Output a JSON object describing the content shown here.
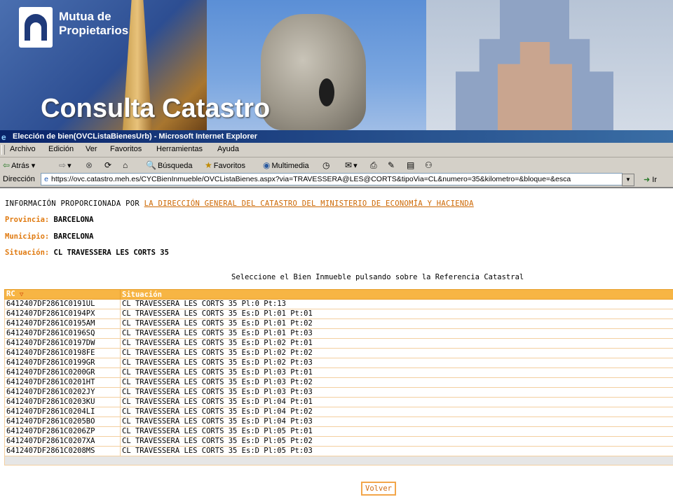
{
  "banner": {
    "logo_line1": "Mutua de",
    "logo_line2": "Propietarios",
    "title": "Consulta Catastro"
  },
  "window": {
    "title": "Elección de bien(OVCListaBienesUrb) - Microsoft Internet Explorer"
  },
  "menu": [
    "Archivo",
    "Edición",
    "Ver",
    "Favoritos",
    "Herramientas",
    "Ayuda"
  ],
  "toolbar": {
    "back": "Atrás",
    "search": "Búsqueda",
    "favorites": "Favoritos",
    "media": "Multimedia"
  },
  "address": {
    "label": "Dirección",
    "url": "https://ovc.catastro.meh.es/CYCBienInmueble/OVCListaBienes.aspx?via=TRAVESSERA@LES@CORTS&tipoVia=CL&numero=35&kilometro=&bloque=&esca",
    "go": "Ir"
  },
  "page": {
    "info_prefix": "INFORMACIÓN PROPORCIONADA POR",
    "info_link": "LA DIRECCIÓN GENERAL DEL CATASTRO DEL MINISTERIO DE ECONOMÍA Y HACIENDA",
    "provincia_label": "Provincia:",
    "provincia_value": "BARCELONA",
    "municipio_label": "Municipio:",
    "municipio_value": "BARCELONA",
    "situacion_label": "Situación:",
    "situacion_value": "CL TRAVESSERA LES CORTS 35",
    "instruction": "Seleccione el Bien Inmueble pulsando sobre la Referencia Catastral",
    "col_rc": "RC",
    "col_situacion": "Situación",
    "back_button": "Volver"
  },
  "rows": [
    {
      "rc": "6412407DF2861C0191UL",
      "sit": "CL TRAVESSERA LES CORTS 35 Pl:0 Pt:13"
    },
    {
      "rc": "6412407DF2861C0194PX",
      "sit": "CL TRAVESSERA LES CORTS 35 Es:D Pl:01 Pt:01"
    },
    {
      "rc": "6412407DF2861C0195AM",
      "sit": "CL TRAVESSERA LES CORTS 35 Es:D Pl:01 Pt:02"
    },
    {
      "rc": "6412407DF2861C0196SQ",
      "sit": "CL TRAVESSERA LES CORTS 35 Es:D Pl:01 Pt:03"
    },
    {
      "rc": "6412407DF2861C0197DW",
      "sit": "CL TRAVESSERA LES CORTS 35 Es:D Pl:02 Pt:01"
    },
    {
      "rc": "6412407DF2861C0198FE",
      "sit": "CL TRAVESSERA LES CORTS 35 Es:D Pl:02 Pt:02"
    },
    {
      "rc": "6412407DF2861C0199GR",
      "sit": "CL TRAVESSERA LES CORTS 35 Es:D Pl:02 Pt:03"
    },
    {
      "rc": "6412407DF2861C0200GR",
      "sit": "CL TRAVESSERA LES CORTS 35 Es:D Pl:03 Pt:01"
    },
    {
      "rc": "6412407DF2861C0201HT",
      "sit": "CL TRAVESSERA LES CORTS 35 Es:D Pl:03 Pt:02"
    },
    {
      "rc": "6412407DF2861C0202JY",
      "sit": "CL TRAVESSERA LES CORTS 35 Es:D Pl:03 Pt:03"
    },
    {
      "rc": "6412407DF2861C0203KU",
      "sit": "CL TRAVESSERA LES CORTS 35 Es:D Pl:04 Pt:01"
    },
    {
      "rc": "6412407DF2861C0204LI",
      "sit": "CL TRAVESSERA LES CORTS 35 Es:D Pl:04 Pt:02"
    },
    {
      "rc": "6412407DF2861C0205BO",
      "sit": "CL TRAVESSERA LES CORTS 35 Es:D Pl:04 Pt:03"
    },
    {
      "rc": "6412407DF2861C0206ZP",
      "sit": "CL TRAVESSERA LES CORTS 35 Es:D Pl:05 Pt:01"
    },
    {
      "rc": "6412407DF2861C0207XA",
      "sit": "CL TRAVESSERA LES CORTS 35 Es:D Pl:05 Pt:02"
    },
    {
      "rc": "6412407DF2861C0208MS",
      "sit": "CL TRAVESSERA LES CORTS 35 Es:D Pl:05 Pt:03"
    }
  ],
  "colors": {
    "label_orange": "#e07a10",
    "header_orange": "#f7b544",
    "titlebar_blue": "#0a246a"
  }
}
